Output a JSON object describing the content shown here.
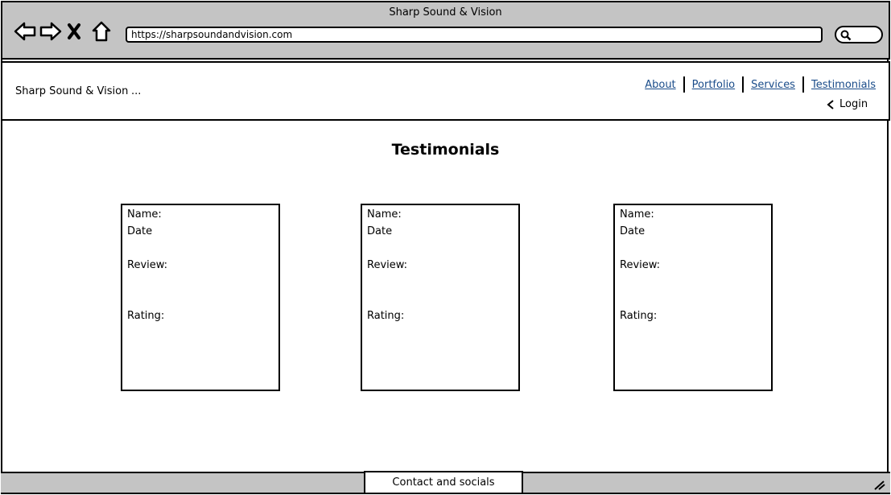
{
  "browser": {
    "title": "Sharp Sound & Vision",
    "url": "https://sharpsoundandvision.com"
  },
  "header": {
    "brand": "Sharp Sound & Vision",
    "ellipsis": "...",
    "nav": {
      "about": "About",
      "portfolio": "Portfolio",
      "services": "Services",
      "testimonials": "Testimonials"
    },
    "login": "Login"
  },
  "page_title": "Testimonials",
  "cards": [
    {
      "name": "Name:",
      "date": "Date",
      "review": "Review:",
      "rating": "Rating:"
    },
    {
      "name": "Name:",
      "date": "Date",
      "review": "Review:",
      "rating": "Rating:"
    },
    {
      "name": "Name:",
      "date": "Date",
      "review": "Review:",
      "rating": "Rating:"
    }
  ],
  "footer": {
    "contact": "Contact and socials"
  },
  "icons": {
    "back": "back-arrow-icon",
    "forward": "forward-arrow-icon",
    "stop": "close-icon",
    "home": "home-icon",
    "search": "search-icon",
    "login": "chevron-left-icon",
    "resize": "resize-grip-icon"
  },
  "colors": {
    "chrome": "#c4c4c4",
    "link": "#1a4c8a"
  }
}
